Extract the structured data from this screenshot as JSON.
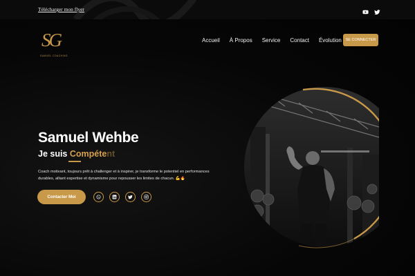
{
  "topbar": {
    "download_link": "Télécharger mon flyer",
    "social_icons": [
      "youtube-icon",
      "twitter-icon"
    ]
  },
  "logo": {
    "monogram": "SG",
    "tagline": "SAMUEL COACHING"
  },
  "nav": {
    "items": [
      {
        "label": "Accueil"
      },
      {
        "label": "À Propos"
      },
      {
        "label": "Service"
      },
      {
        "label": "Contact"
      },
      {
        "label": "Évolution"
      }
    ],
    "login_button": "SE CONNECTER"
  },
  "hero": {
    "name": "Samuel Wehbe",
    "subtitle_prefix": "Je suis",
    "subtitle_word": "Compéte",
    "subtitle_word_fading": "nt",
    "description": "Coach motivant, toujours prêt à challenger et à inspirer, je transforme le potentiel en performances durables, alliant expertise et dynamisme pour repousser les limites de chacun. 💪🔥",
    "contact_button": "Contacter Moi",
    "social_icons": [
      "whatsapp-icon",
      "linkedin-icon",
      "twitter-icon",
      "instagram-icon"
    ]
  },
  "colors": {
    "accent": "#c9994a",
    "background": "#050505",
    "text": "#ffffff"
  }
}
